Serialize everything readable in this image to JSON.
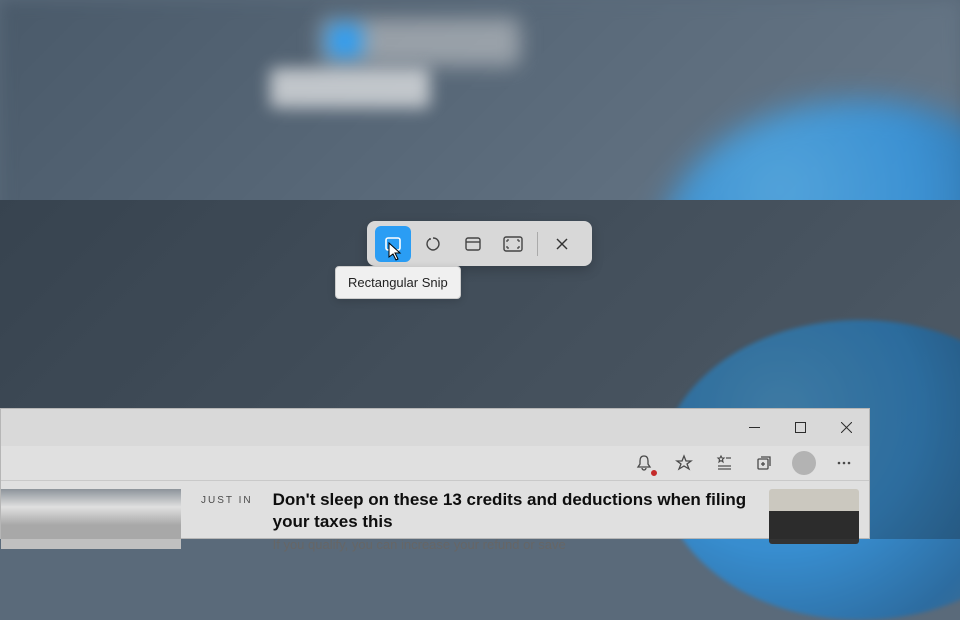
{
  "snip": {
    "tooltip": "Rectangular Snip",
    "buttons": [
      {
        "name": "rectangular-snip",
        "active": true
      },
      {
        "name": "freeform-snip",
        "active": false
      },
      {
        "name": "window-snip",
        "active": false
      },
      {
        "name": "fullscreen-snip",
        "active": false
      }
    ],
    "close": "Close"
  },
  "browser": {
    "badge": "JUST IN",
    "headline": "Don't sleep on these 13 credits and deductions when filing your taxes this",
    "subline": "If you qualify, you can increase your refund or save"
  }
}
